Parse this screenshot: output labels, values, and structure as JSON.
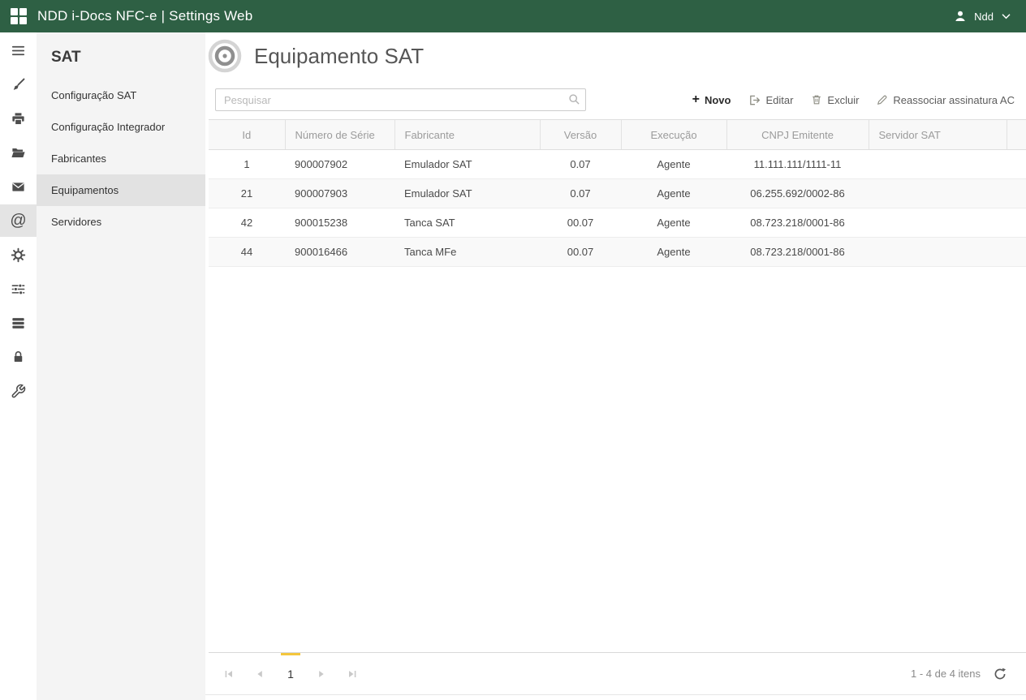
{
  "colors": {
    "topbar_green": "#2e6044",
    "pager_accent": "#f4c63d",
    "sidebar_bg": "#f4f4f4",
    "selected_item_bg": "#e2e2e2"
  },
  "topbar": {
    "title": "NDD i-Docs NFC-e | Settings Web",
    "user_name": "Ndd"
  },
  "icon_rail": {
    "items": [
      "menu",
      "brush",
      "printer",
      "folder-open",
      "mail",
      "at-sign",
      "gear",
      "sliders",
      "stack",
      "lock",
      "wrench"
    ],
    "selected": "at-sign",
    "at_glyph": "@"
  },
  "sidebar": {
    "title": "SAT",
    "items": [
      {
        "label": "Configuração SAT",
        "selected": false
      },
      {
        "label": "Configuração Integrador",
        "selected": false
      },
      {
        "label": "Fabricantes",
        "selected": false
      },
      {
        "label": "Equipamentos",
        "selected": true
      },
      {
        "label": "Servidores",
        "selected": false
      }
    ]
  },
  "main": {
    "page_title": "Equipamento SAT",
    "search": {
      "placeholder": "Pesquisar"
    },
    "actions": [
      {
        "label": "Novo",
        "glyph": "+",
        "icon": "plus"
      },
      {
        "label": "Editar",
        "icon": "edit-arrow"
      },
      {
        "label": "Excluir",
        "icon": "trash"
      },
      {
        "label": "Reassociar assinatura AC",
        "icon": "pencil"
      }
    ],
    "table": {
      "columns": [
        "Id",
        "Número de Série",
        "Fabricante",
        "Versão",
        "Execução",
        "CNPJ Emitente",
        "Servidor SAT"
      ],
      "rows": [
        [
          "1",
          "900007902",
          "Emulador SAT",
          "0.07",
          "Agente",
          "11.111.111/1111-11",
          ""
        ],
        [
          "21",
          "900007903",
          "Emulador SAT",
          "0.07",
          "Agente",
          "06.255.692/0002-86",
          ""
        ],
        [
          "42",
          "900015238",
          "Tanca SAT",
          "00.07",
          "Agente",
          "08.723.218/0001-86",
          ""
        ],
        [
          "44",
          "900016466",
          "Tanca MFe",
          "00.07",
          "Agente",
          "08.723.218/0001-86",
          ""
        ]
      ]
    },
    "pager": {
      "current_page": "1",
      "status": "1 - 4 de 4 itens"
    }
  }
}
